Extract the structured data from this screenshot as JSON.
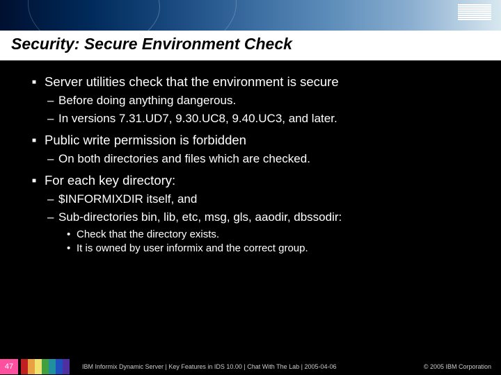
{
  "logo": "IBM",
  "title": "Security: Secure Environment Check",
  "bullets": {
    "b1_1": "Server utilities check that the environment is secure",
    "b2_1": "Before doing anything dangerous.",
    "b2_2": "In versions 7.31.UD7, 9.30.UC8, 9.40.UC3, and later.",
    "b1_2": "Public write permission is forbidden",
    "b2_3": "On both directories and files which are checked.",
    "b1_3": "For each key directory:",
    "b2_4": "$INFORMIXDIR itself, and",
    "b2_5": "Sub-directories bin, lib, etc, msg, gls, aaodir, dbssodir:",
    "b3_1": "Check that the directory exists.",
    "b3_2": "It is owned by user informix and the correct group."
  },
  "footer": {
    "slide_number": "47",
    "text": "IBM Informix Dynamic Server  |  Key Features in IDS 10.00  |  Chat With The Lab  |  2005-04-06",
    "copyright": "© 2005 IBM Corporation"
  }
}
